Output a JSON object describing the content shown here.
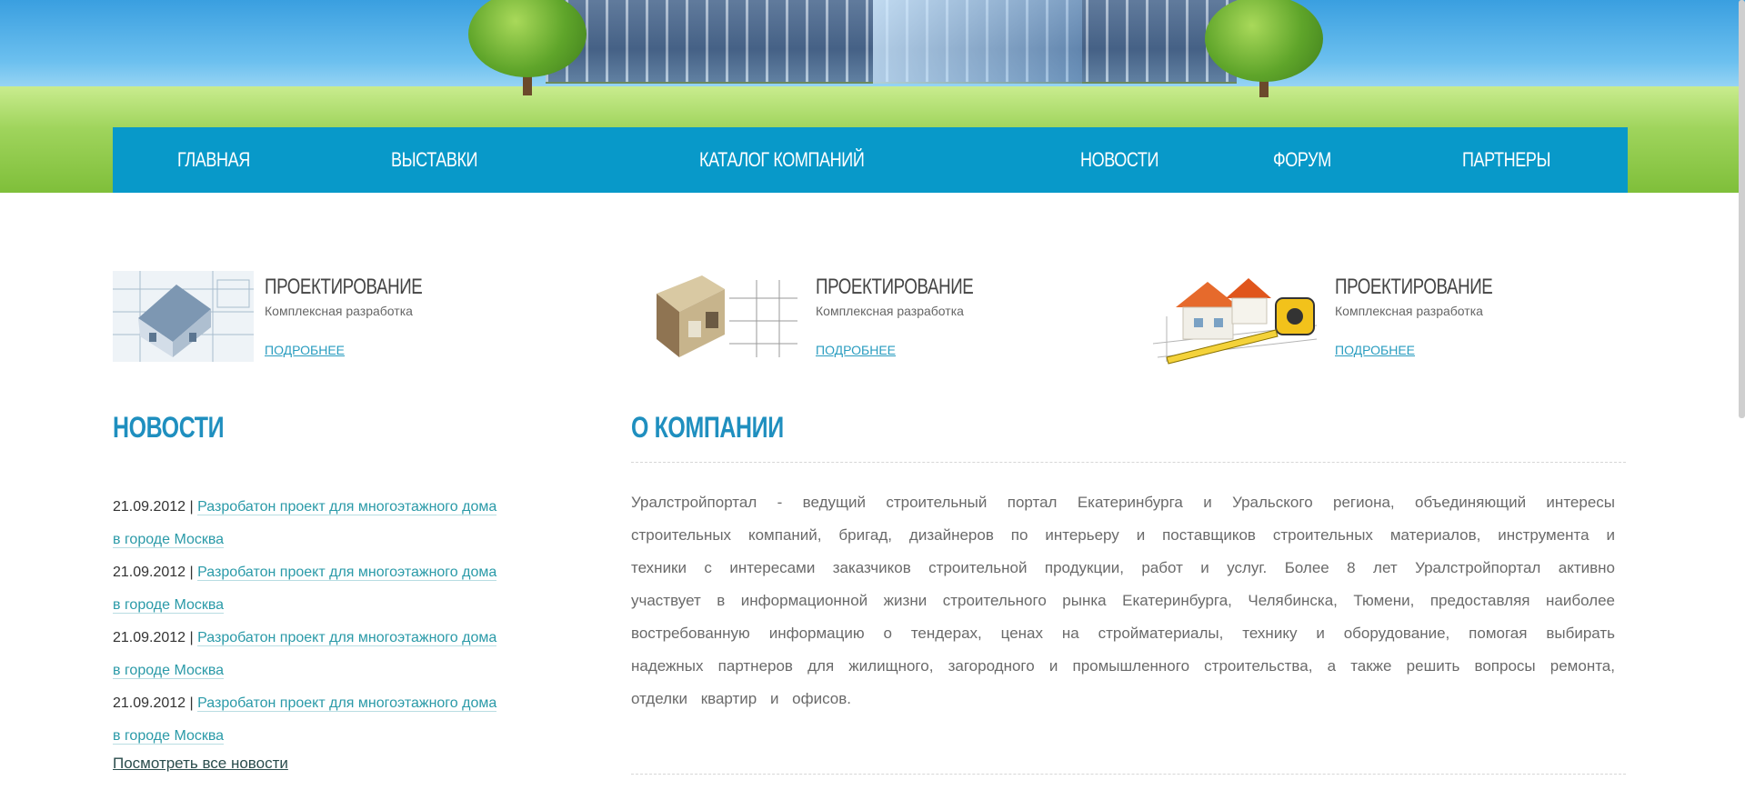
{
  "nav": {
    "items": [
      {
        "label": "ГЛАВНАЯ"
      },
      {
        "label": "ВЫСТАВКИ"
      },
      {
        "label": "КАТАЛОГ КОМПАНИЙ"
      },
      {
        "label": "НОВОСТИ"
      },
      {
        "label": "ФОРУМ"
      },
      {
        "label": "ПАРТНЕРЫ"
      }
    ]
  },
  "services": [
    {
      "title": "ПРОЕКТИРОВАНИЕ",
      "subtitle": "Комплексная разработка",
      "more": "ПОДРОБНЕЕ",
      "image": "house-blueprint-image"
    },
    {
      "title": "ПРОЕКТИРОВАНИЕ",
      "subtitle": "Комплексная разработка",
      "more": "ПОДРОБНЕЕ",
      "image": "interior-plan-image"
    },
    {
      "title": "ПРОЕКТИРОВАНИЕ",
      "subtitle": "Комплексная разработка",
      "more": "ПОДРОБНЕЕ",
      "image": "house-tape-measure-image"
    }
  ],
  "news": {
    "title": "НОВОСТИ",
    "items": [
      {
        "date": "21.09.2012",
        "separator": " | ",
        "text": "Разробатон проект для многоэтажного дома в городе Москва"
      },
      {
        "date": "21.09.2012",
        "separator": " | ",
        "text": "Разробатон проект для многоэтажного дома в городе Москва"
      },
      {
        "date": "21.09.2012",
        "separator": " | ",
        "text": "Разробатон проект для многоэтажного дома в городе Москва"
      },
      {
        "date": "21.09.2012",
        "separator": " | ",
        "text": "Разробатон проект для многоэтажного дома в городе Москва"
      }
    ],
    "all_link": "Посмотреть все новости"
  },
  "about": {
    "title": "О КОМПАНИИ",
    "text": "Уралстройпортал - ведущий строительный портал Екатеринбурга и Уральского региона, объединяющий интересы строительных компаний, бригад, дизайнеров по интерьеру и поставщиков строительных материалов, инструмента и техники с интересами заказчиков строительной продукции, работ и услуг. Более 8 лет Уралстройпортал активно участвует в информационной жизни строительного рынка Екатеринбурга, Челябинска, Тюмени, предоставляя наиболее востребованную информацию о тендерах, ценах на стройматериалы, технику и оборудование, помогая выбирать надежных партнеров для жилищного, загородного и промышленного строительства, а также решить вопросы ремонта, отделки квартир и офисов."
  },
  "colors": {
    "nav_bg": "#0899c9",
    "section_title": "#1f8fbf",
    "link": "#2a9aa8"
  }
}
